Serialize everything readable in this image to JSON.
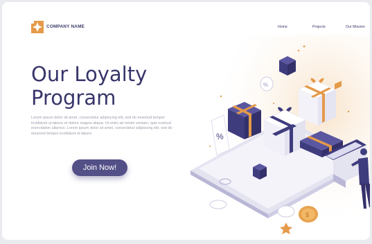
{
  "header": {
    "company_name": "COMPANY NAME",
    "logo_icon": "compass-star-logo",
    "nav": [
      {
        "label": "Home"
      },
      {
        "label": "Projects"
      },
      {
        "label": "Our Mission"
      }
    ]
  },
  "hero": {
    "title_line1": "Our Loyalty",
    "title_line2": "Program",
    "paragraph": "Lorem ipsum dolor sit amet, consectetur adipiscing elit, sed do eiusmod tempor incididunt ut labore et dolore magna aliqua. Ut enim ad minim veniam, quis nostrud exercitation ullamco. Lorem ipsum dolor sit amet, consectetur adipiscing elit, sed do eiusmod tempor incididunt ut labore.",
    "cta_label": "Join Now!"
  },
  "illustration": {
    "percent_symbol": "%",
    "colors": {
      "navy": "#3f3c7e",
      "orange": "#e49a4a",
      "white": "#ffffff",
      "light": "#ecebf6"
    }
  }
}
